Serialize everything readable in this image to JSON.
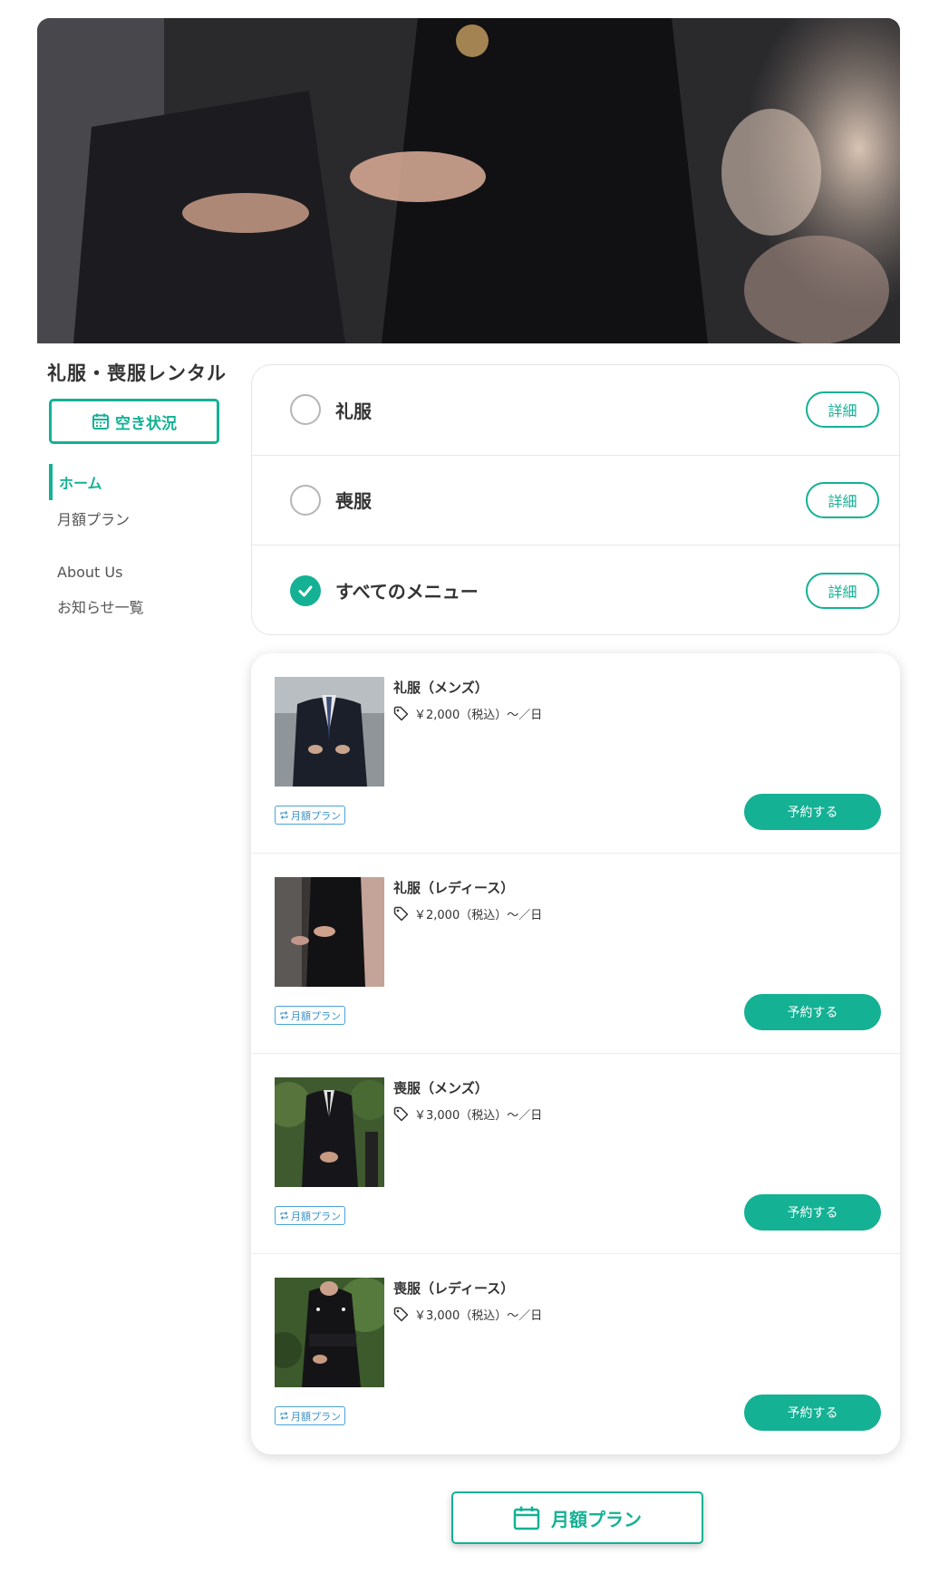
{
  "site": {
    "title": "礼服・喪服レンタル"
  },
  "sidebar": {
    "availability_label": "空き状況",
    "availability_icon": "calendar-icon",
    "nav": [
      {
        "label": "ホーム",
        "active": true
      },
      {
        "label": "月額プラン",
        "active": false
      },
      {
        "label": "About Us",
        "active": false
      },
      {
        "label": "お知らせ一覧",
        "active": false
      }
    ]
  },
  "categories": [
    {
      "label": "礼服",
      "checked": false,
      "detail_label": "詳細"
    },
    {
      "label": "喪服",
      "checked": false,
      "detail_label": "詳細"
    },
    {
      "label": "すべてのメニュー",
      "checked": true,
      "detail_label": "詳細"
    }
  ],
  "products": [
    {
      "name": "礼服（メンズ）",
      "price": "￥2,000（税込）〜／日",
      "badge": "月額プラン",
      "button": "予約する"
    },
    {
      "name": "礼服（レディース）",
      "price": "￥2,000（税込）〜／日",
      "badge": "月額プラン",
      "button": "予約する"
    },
    {
      "name": "喪服（メンズ）",
      "price": "￥3,000（税込）〜／日",
      "badge": "月額プラン",
      "button": "予約する"
    },
    {
      "name": "喪服（レディース）",
      "price": "￥3,000（税込）〜／日",
      "badge": "月額プラン",
      "button": "予約する"
    }
  ],
  "footer": {
    "monthly_label": "月額プラン"
  },
  "colors": {
    "accent": "#14b194",
    "badge": "#4aa3d8"
  }
}
